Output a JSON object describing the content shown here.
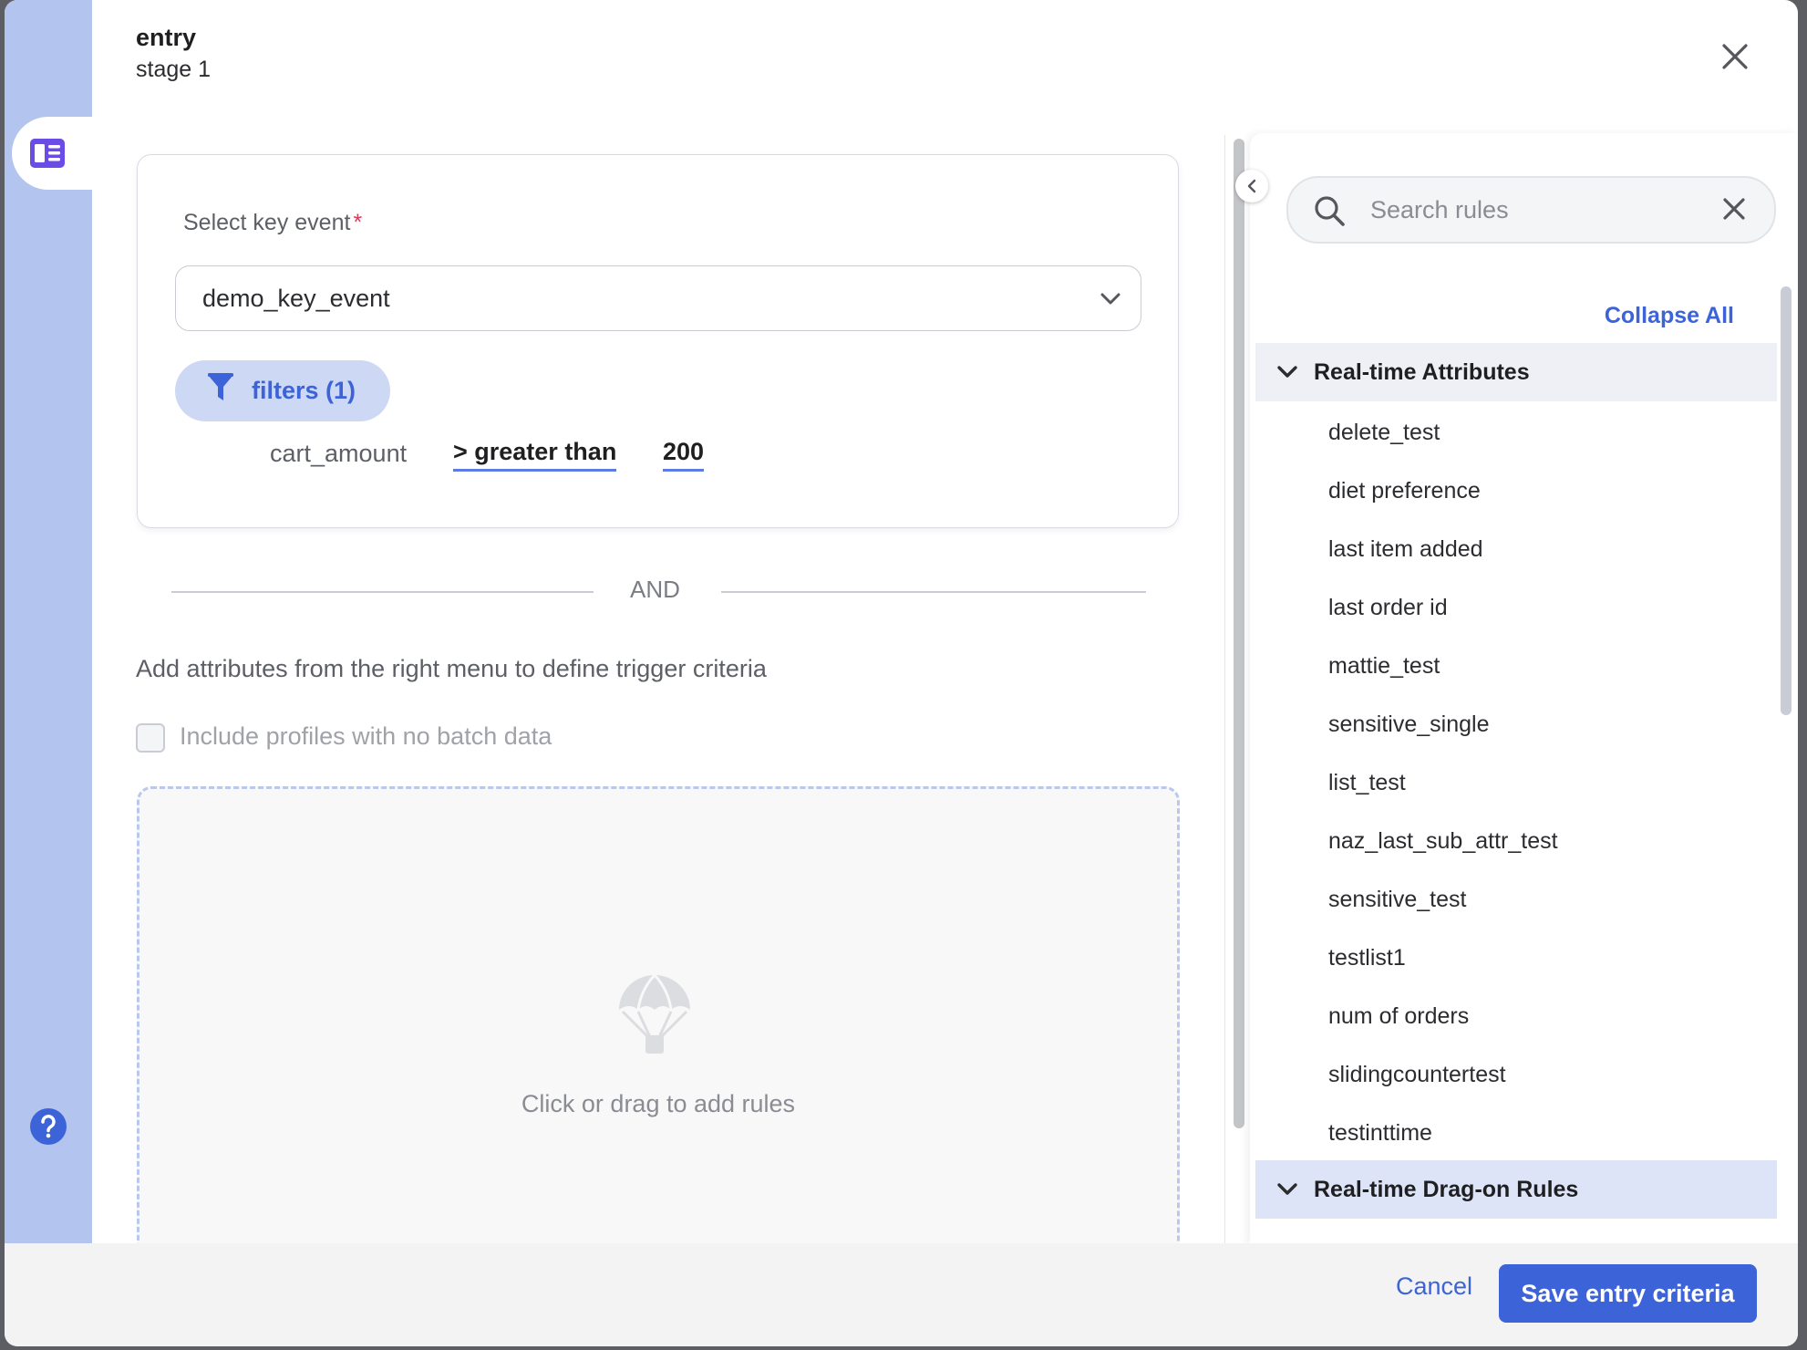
{
  "header": {
    "title": "entry",
    "subtitle": "stage 1"
  },
  "key_event": {
    "label": "Select key event",
    "required_mark": "*",
    "selected_value": "demo_key_event"
  },
  "filters": {
    "label": "filters (1)",
    "condition": {
      "attribute": "cart_amount",
      "operator": "> greater than",
      "value": "200"
    }
  },
  "divider_text": "AND",
  "hint_text": "Add attributes from the right menu to define trigger criteria",
  "checkbox": {
    "label": "Include profiles with no batch data",
    "checked": false
  },
  "dropzone_text": "Click or drag to add rules",
  "right_panel": {
    "search_placeholder": "Search rules",
    "collapse_all_label": "Collapse All",
    "groups": [
      {
        "title": "Real-time Attributes",
        "expanded": true,
        "items": [
          "delete_test",
          "diet preference",
          "last item added",
          "last order id",
          "mattie_test",
          "sensitive_single",
          "list_test",
          "naz_last_sub_attr_test",
          "sensitive_test",
          "testlist1",
          "num of orders",
          "slidingcountertest",
          "testinttime"
        ]
      },
      {
        "title": "Real-time Drag-on Rules",
        "expanded": true,
        "items": []
      }
    ]
  },
  "footer": {
    "cancel_label": "Cancel",
    "save_label": "Save entry criteria"
  },
  "colors": {
    "accent": "#3d63d8",
    "rail": "#b3c4ee",
    "pill": "#cdd8f5",
    "required": "#d83a52"
  }
}
